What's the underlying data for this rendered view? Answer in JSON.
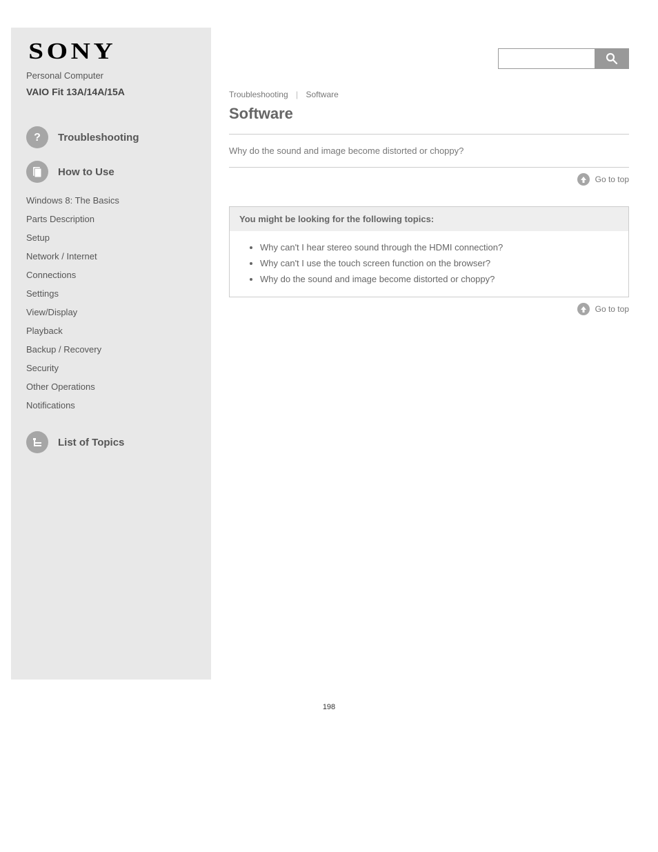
{
  "sidebar": {
    "brand": "SONY",
    "product_name": "Personal Computer",
    "product_model": "VAIO Fit 13A/14A/15A",
    "sections": {
      "howto": {
        "title": "How to Use",
        "items": [
          {
            "label": "Windows 8: The Basics"
          },
          {
            "label": "Parts Description"
          },
          {
            "label": "Setup"
          },
          {
            "label": "Network / Internet"
          },
          {
            "label": "Connections"
          },
          {
            "label": "Settings"
          },
          {
            "label": "View/Display"
          },
          {
            "label": "Playback"
          },
          {
            "label": "Backup / Recovery"
          },
          {
            "label": "Security"
          },
          {
            "label": "Other Operations"
          },
          {
            "label": "Notifications"
          }
        ]
      },
      "trouble": {
        "title": "Troubleshooting"
      },
      "contents": {
        "title": "List of Topics"
      }
    }
  },
  "search": {
    "placeholder": ""
  },
  "content": {
    "breadcrumb": {
      "left": "Troubleshooting",
      "right": "Software"
    },
    "title": "Software",
    "category_link": "Why do the sound and image become distorted or choppy?",
    "go_top": "Go to top",
    "related": {
      "heading": "You might be looking for the following topics:",
      "items": [
        "Why can't I hear stereo sound through the HDMI connection?",
        "Why can't I use the touch screen function on the browser?",
        "Why do the sound and image become distorted or choppy?"
      ]
    }
  },
  "page_number": "198"
}
